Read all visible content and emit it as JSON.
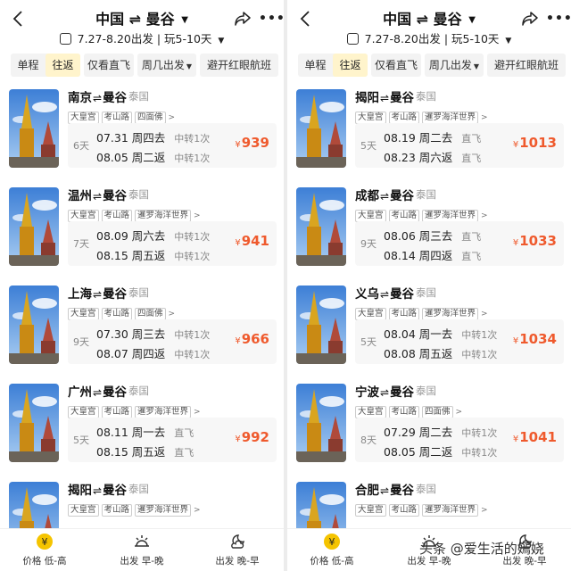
{
  "header": {
    "origin": "中国",
    "destination": "曼谷",
    "date_range": "7.27-8.20出发",
    "duration": "玩5-10天"
  },
  "filters": {
    "one_way": "单程",
    "round_trip": "往返",
    "direct_only": "仅看直飞",
    "weekday": "周几出发",
    "avoid_redeye": "避开红眼航班"
  },
  "left_cards": [
    {
      "city": "南京",
      "dest": "曼谷",
      "country": "泰国",
      "tags": [
        "大皇宫",
        "考山路",
        "四面佛"
      ],
      "days": "6天",
      "out_date": "07.31",
      "out_day": "周四去",
      "out_mode": "中转1次",
      "ret_date": "08.05",
      "ret_day": "周二返",
      "ret_mode": "中转1次",
      "yen": "¥",
      "price": "939"
    },
    {
      "city": "温州",
      "dest": "曼谷",
      "country": "泰国",
      "tags": [
        "大皇宫",
        "考山路",
        "暹罗海洋世界"
      ],
      "days": "7天",
      "out_date": "08.09",
      "out_day": "周六去",
      "out_mode": "中转1次",
      "ret_date": "08.15",
      "ret_day": "周五返",
      "ret_mode": "中转1次",
      "yen": "¥",
      "price": "941"
    },
    {
      "city": "上海",
      "dest": "曼谷",
      "country": "泰国",
      "tags": [
        "大皇宫",
        "考山路",
        "四面佛"
      ],
      "days": "9天",
      "out_date": "07.30",
      "out_day": "周三去",
      "out_mode": "中转1次",
      "ret_date": "08.07",
      "ret_day": "周四返",
      "ret_mode": "中转1次",
      "yen": "¥",
      "price": "966"
    },
    {
      "city": "广州",
      "dest": "曼谷",
      "country": "泰国",
      "tags": [
        "大皇宫",
        "考山路",
        "暹罗海洋世界"
      ],
      "days": "5天",
      "out_date": "08.11",
      "out_day": "周一去",
      "out_mode": "直飞",
      "ret_date": "08.15",
      "ret_day": "周五返",
      "ret_mode": "直飞",
      "yen": "¥",
      "price": "992"
    },
    {
      "city": "揭阳",
      "dest": "曼谷",
      "country": "泰国",
      "tags": [
        "大皇宫",
        "考山路",
        "暹罗海洋世界"
      ]
    }
  ],
  "right_cards": [
    {
      "city": "揭阳",
      "dest": "曼谷",
      "country": "泰国",
      "tags": [
        "大皇宫",
        "考山路",
        "暹罗海洋世界"
      ],
      "days": "5天",
      "out_date": "08.19",
      "out_day": "周二去",
      "out_mode": "直飞",
      "ret_date": "08.23",
      "ret_day": "周六返",
      "ret_mode": "直飞",
      "yen": "¥",
      "price": "1013"
    },
    {
      "city": "成都",
      "dest": "曼谷",
      "country": "泰国",
      "tags": [
        "大皇宫",
        "考山路",
        "暹罗海洋世界"
      ],
      "days": "9天",
      "out_date": "08.06",
      "out_day": "周三去",
      "out_mode": "直飞",
      "ret_date": "08.14",
      "ret_day": "周四返",
      "ret_mode": "直飞",
      "yen": "¥",
      "price": "1033"
    },
    {
      "city": "义乌",
      "dest": "曼谷",
      "country": "泰国",
      "tags": [
        "大皇宫",
        "考山路",
        "暹罗海洋世界"
      ],
      "days": "5天",
      "out_date": "08.04",
      "out_day": "周一去",
      "out_mode": "中转1次",
      "ret_date": "08.08",
      "ret_day": "周五返",
      "ret_mode": "中转1次",
      "yen": "¥",
      "price": "1034"
    },
    {
      "city": "宁波",
      "dest": "曼谷",
      "country": "泰国",
      "tags": [
        "大皇宫",
        "考山路",
        "四面佛"
      ],
      "days": "8天",
      "out_date": "07.29",
      "out_day": "周二去",
      "out_mode": "中转1次",
      "ret_date": "08.05",
      "ret_day": "周二返",
      "ret_mode": "中转1次",
      "yen": "¥",
      "price": "1041"
    },
    {
      "city": "合肥",
      "dest": "曼谷",
      "country": "泰国",
      "tags": [
        "大皇宫",
        "考山路",
        "暹罗海洋世界"
      ]
    }
  ],
  "bottom_bar": {
    "price_sort": "价格 低-高",
    "depart_sort": "出发 早-晚",
    "return_sort": "出发 晚-早"
  },
  "watermark": "头条 @爱生活的嫣娆",
  "colors": {
    "price": "#ef5a2d",
    "active_chip_bg": "#fff4cc",
    "accent_yellow": "#f5c400"
  }
}
